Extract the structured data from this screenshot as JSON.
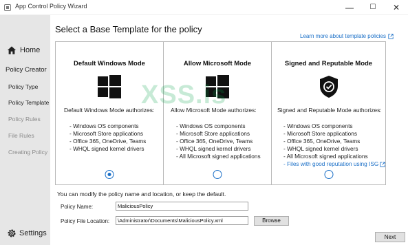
{
  "window": {
    "title": "App Control Policy Wizard"
  },
  "sidebar": {
    "home": "Home",
    "section": "Policy Creator",
    "items": [
      {
        "label": "Policy Type"
      },
      {
        "label": "Policy Template"
      },
      {
        "label": "Policy Rules"
      },
      {
        "label": "File Rules"
      },
      {
        "label": "Creating Policy"
      }
    ],
    "settings": "Settings"
  },
  "main": {
    "title": "Select a Base Template for the policy",
    "learn_link": "Learn more about template policies",
    "cards": [
      {
        "title": "Default Windows Mode",
        "icon": "windows-logo-icon",
        "desc": "Default Windows Mode authorizes:",
        "items": [
          "- Windows OS components",
          "- Microsoft Store applications",
          "- Office 365, OneDrive, Teams",
          "- WHQL signed kernel drivers"
        ],
        "selected": true
      },
      {
        "title": "Allow Microsoft Mode",
        "icon": "windows-logo-icon",
        "desc": "Allow Microsoft Mode authorizes:",
        "items": [
          "- Windows OS components",
          "- Microsoft Store applications",
          "- Office 365, OneDrive, Teams",
          "- WHQL signed kernel drivers",
          "- All Microsoft signed applications"
        ],
        "selected": false
      },
      {
        "title": "Signed and Reputable Mode",
        "icon": "shield-check-icon",
        "desc": "Signed and Reputable Mode authorizes:",
        "items": [
          "- Windows OS components",
          "- Microsoft Store applications",
          "- Office 365, OneDrive, Teams",
          "- WHQL signed kernel drivers",
          "- All Microsoft signed applications"
        ],
        "link_item": "- Files with good reputation using ISG",
        "selected": false
      }
    ],
    "watermark": "XSS.is",
    "form": {
      "note": "You can modify the policy name and location, or keep the default.",
      "name_label": "Policy Name:",
      "name_value": "MaliciousPolicy",
      "location_label": "Policy File Location:",
      "location_value": "\\Administrator\\Documents\\MaliciousPolicy.xml",
      "browse": "Browse"
    },
    "next": "Next"
  },
  "colors": {
    "accent": "#1a6fc7",
    "sidebar_bg": "#e6e6e6",
    "watermark": "#00a046"
  }
}
